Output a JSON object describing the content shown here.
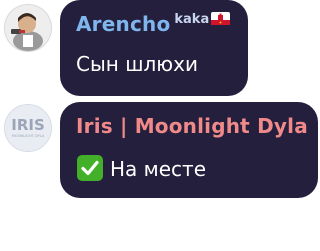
{
  "messages": [
    {
      "sender": "Arencho",
      "tag": "kaka",
      "text": "Сын шлюхи",
      "name_color": "#7fb6ee",
      "flag_icon": "gibraltar-flag-icon"
    },
    {
      "sender": "Iris | Moonlight Dyla",
      "avatar_text": "IRIS",
      "avatar_subtext": "MOONLIGHT DYLA",
      "text": "На месте",
      "name_color": "#f08a8a",
      "status_icon": "check-mark-button-icon"
    }
  ],
  "colors": {
    "bubble_bg": "#241f3c",
    "check_green": "#43b02a"
  }
}
